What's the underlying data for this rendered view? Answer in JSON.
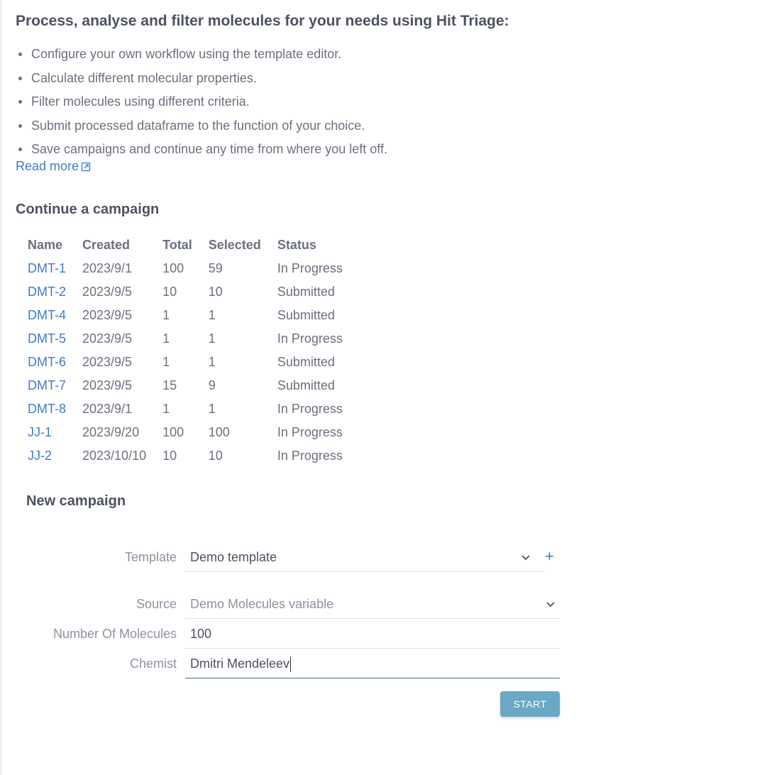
{
  "intro": {
    "headline": "Process, analyse and filter molecules for your needs using Hit Triage:",
    "features": [
      "Configure your own workflow using the template editor.",
      "Calculate different molecular properties.",
      "Filter molecules using different criteria.",
      "Submit processed dataframe to the function of your choice.",
      "Save campaigns and continue any time from where you left off."
    ],
    "read_more": "Read more",
    "read_more_icon": "external-link-icon"
  },
  "continue": {
    "title": "Continue a campaign",
    "columns": [
      "Name",
      "Created",
      "Total",
      "Selected",
      "Status"
    ],
    "rows": [
      {
        "name": "DMT-1",
        "created": "2023/9/1",
        "total": "100",
        "selected": "59",
        "status": "In Progress"
      },
      {
        "name": "DMT-2",
        "created": "2023/9/5",
        "total": "10",
        "selected": "10",
        "status": "Submitted"
      },
      {
        "name": "DMT-4",
        "created": "2023/9/5",
        "total": "1",
        "selected": "1",
        "status": "Submitted"
      },
      {
        "name": "DMT-5",
        "created": "2023/9/5",
        "total": "1",
        "selected": "1",
        "status": "In Progress"
      },
      {
        "name": "DMT-6",
        "created": "2023/9/5",
        "total": "1",
        "selected": "1",
        "status": "Submitted"
      },
      {
        "name": "DMT-7",
        "created": "2023/9/5",
        "total": "15",
        "selected": "9",
        "status": "Submitted"
      },
      {
        "name": "DMT-8",
        "created": "2023/9/1",
        "total": "1",
        "selected": "1",
        "status": "In Progress"
      },
      {
        "name": "JJ-1",
        "created": "2023/9/20",
        "total": "100",
        "selected": "100",
        "status": "In Progress"
      },
      {
        "name": "JJ-2",
        "created": "2023/10/10",
        "total": "10",
        "selected": "10",
        "status": "In Progress"
      }
    ]
  },
  "new_campaign": {
    "title": "New campaign",
    "template": {
      "label": "Template",
      "value": "Demo template",
      "add_symbol": "+"
    },
    "source": {
      "label": "Source",
      "value": "Demo Molecules variable"
    },
    "number_of_molecules": {
      "label": "Number Of Molecules",
      "value": "100"
    },
    "chemist": {
      "label": "Chemist",
      "value": "Dmitri Mendeleev"
    },
    "start_label": "START"
  },
  "colors": {
    "link": "#3f7bc9",
    "start_button": "#6aa8c4",
    "text": "#4d5261",
    "muted": "#8e92a0"
  }
}
